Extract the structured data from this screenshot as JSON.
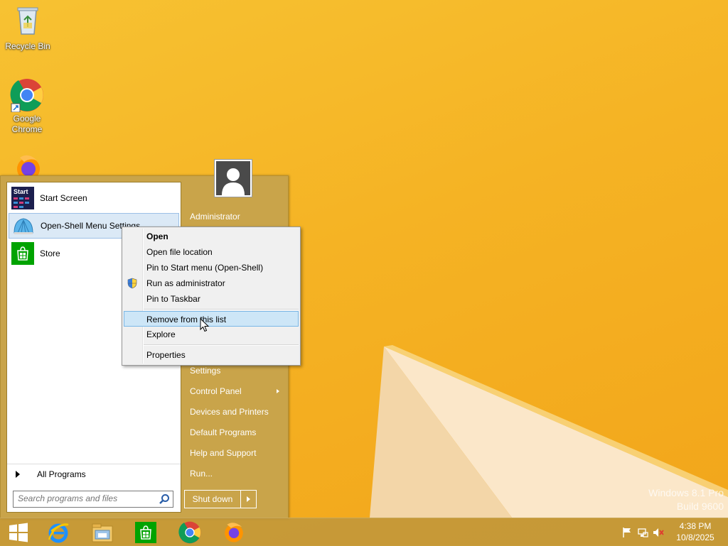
{
  "desktop": {
    "icons": [
      {
        "label": "Recycle Bin",
        "icon": "recycle-bin-icon"
      },
      {
        "label": "Google\nChrome",
        "icon": "chrome-icon"
      },
      {
        "label": "",
        "icon": "firefox-icon"
      }
    ],
    "watermark": {
      "line1": "Windows 8.1 Pro",
      "line2": "Build 9600"
    }
  },
  "start_menu": {
    "programs": [
      {
        "label": "Start Screen",
        "icon": "start-screen-icon"
      },
      {
        "label": "Open-Shell Menu Settings",
        "icon": "shell-icon",
        "selected": true
      },
      {
        "label": "Store",
        "icon": "store-icon"
      }
    ],
    "all_programs": "All Programs",
    "search_placeholder": "Search programs and files",
    "right_items": {
      "user": "Administrator",
      "settings": "Settings",
      "control_panel": "Control Panel",
      "devices": "Devices and Printers",
      "default_programs": "Default Programs",
      "help": "Help and Support",
      "run": "Run..."
    },
    "shutdown": "Shut down"
  },
  "context_menu": {
    "items": [
      {
        "label": "Open",
        "bold": true
      },
      {
        "label": "Open file location"
      },
      {
        "label": "Pin to Start menu (Open-Shell)"
      },
      {
        "label": "Run as administrator",
        "icon": "uac-shield-icon"
      },
      {
        "label": "Pin to Taskbar"
      },
      {
        "label": "Remove from this list",
        "highlighted": true
      },
      {
        "label": "Explore"
      },
      {
        "label": "Properties"
      }
    ]
  },
  "taskbar": {
    "apps": [
      "start-icon",
      "internet-explorer-icon",
      "file-explorer-icon",
      "store-icon",
      "chrome-icon",
      "firefox-icon"
    ],
    "clock": {
      "time": "4:38 PM",
      "date": "10/8/2025"
    }
  }
}
